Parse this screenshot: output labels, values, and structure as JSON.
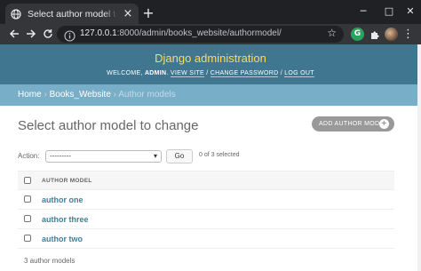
{
  "browser": {
    "tab_title": "Select author model to change",
    "tab_close": "×",
    "new_tab": "+",
    "window_controls": [
      "─",
      "□",
      "✕"
    ],
    "url_host": "127.0.0.1",
    "url_path": ":8000/admin/books_website/authormodel/",
    "extension_badge": "G"
  },
  "header": {
    "site_title": "Django administration",
    "welcome": "WELCOME,",
    "username": "ADMIN",
    "view_site": "VIEW SITE",
    "change_password": "CHANGE PASSWORD",
    "log_out": "LOG OUT",
    "separator": "/"
  },
  "breadcrumbs": {
    "home": "Home",
    "app": "Books_Website",
    "current": "Author models",
    "separator": "›"
  },
  "content": {
    "title": "Select author model to change",
    "add_button": "ADD AUTHOR MODEL"
  },
  "actions": {
    "label": "Action:",
    "selected_value": "---------",
    "go_label": "Go",
    "selection_count": "0 of 3 selected"
  },
  "table": {
    "header": "AUTHOR MODEL",
    "rows": [
      {
        "name": "author one"
      },
      {
        "name": "author three"
      },
      {
        "name": "author two"
      }
    ]
  },
  "paginator": "3 author models",
  "colors": {
    "header_bg": "#417690",
    "site_title": "#f5dd5d",
    "breadcrumbs_bg": "#79aec8",
    "link": "#447e9b",
    "add_button_bg": "#999999"
  }
}
